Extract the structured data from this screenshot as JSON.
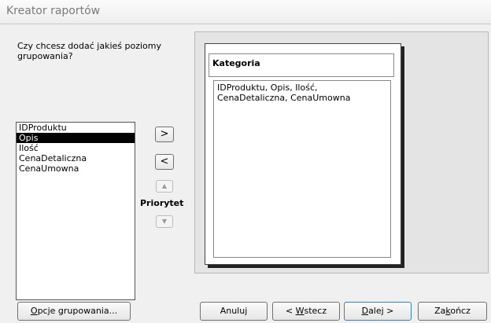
{
  "window": {
    "title": "Kreator raportów"
  },
  "question": "Czy chcesz dodać jakieś poziomy grupowania?",
  "fields": [
    "IDProduktu",
    "Opis",
    "Ilość",
    "CenaDetaliczna",
    "CenaUmowna"
  ],
  "selected_field": "Opis",
  "buttons": {
    "add": ">",
    "remove": "<",
    "priority_up_icon": "arrow-up-icon",
    "priority_down_icon": "arrow-down-icon",
    "priority_label": "Priorytet"
  },
  "preview": {
    "group_header": "Kategoria",
    "detail_text": "IDProduktu, Opis, Ilość, CenaDetaliczna, CenaUmowna"
  },
  "footer": {
    "options": {
      "prefix": "",
      "key": "O",
      "rest": "pcje grupowania..."
    },
    "cancel": "Anuluj",
    "back": {
      "prefix": "< ",
      "key": "W",
      "rest": "stecz"
    },
    "next": {
      "prefix": "",
      "key": "D",
      "rest": "alej >"
    },
    "finish": {
      "prefix": "Za",
      "key": "k",
      "rest": "ończ"
    }
  }
}
